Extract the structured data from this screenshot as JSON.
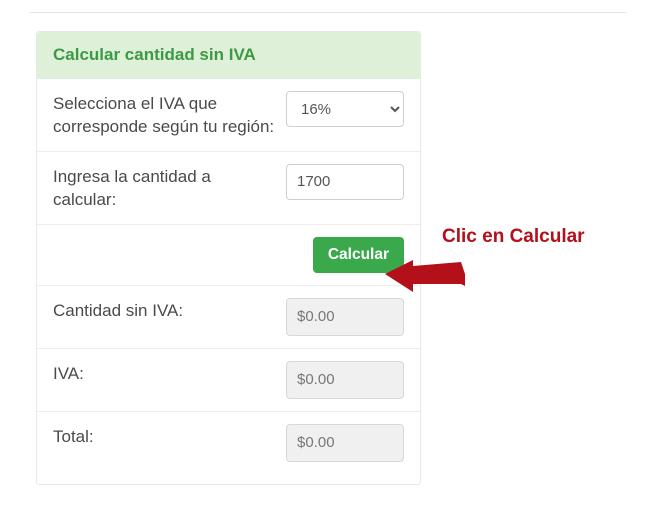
{
  "header": {
    "title": "Calcular cantidad sin IVA"
  },
  "rows": {
    "select_iva": {
      "label": "Selecciona el IVA que corresponde según tu región:",
      "selected": "16%"
    },
    "amount": {
      "label": "Ingresa la cantidad a calcular:",
      "value": "1700"
    },
    "calc_button": "Calcular",
    "result_noiva": {
      "label": "Cantidad sin IVA:",
      "value": "$0.00"
    },
    "result_iva": {
      "label": "IVA:",
      "value": "$0.00"
    },
    "result_total": {
      "label": "Total:",
      "value": "$0.00"
    }
  },
  "annotation": "Clic en Calcular"
}
